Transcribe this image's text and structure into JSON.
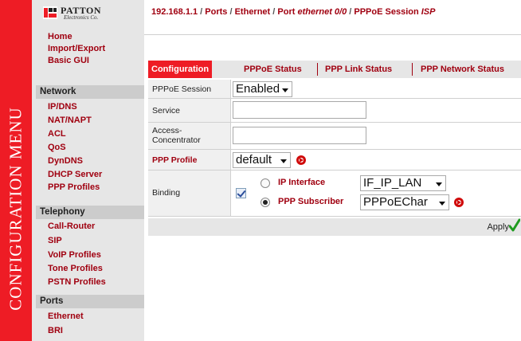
{
  "banner": {
    "text": "CONFIGURATION MENU",
    "color": "#ee1c25"
  },
  "logo": {
    "word": "PATTON",
    "sub": "Electronics Co."
  },
  "menu": {
    "top_items": [
      "Home",
      "Import/Export",
      "Basic GUI"
    ],
    "sections": [
      {
        "title": "Network",
        "items": [
          "IP/DNS",
          "NAT/NAPT",
          "ACL",
          "QoS",
          "DynDNS",
          "DHCP Server",
          "PPP Profiles"
        ]
      },
      {
        "title": "Telephony",
        "items": [
          "Call-Router",
          "SIP",
          "VoIP Profiles",
          "Tone Profiles",
          "PSTN Profiles"
        ]
      },
      {
        "title": "Ports",
        "items": [
          "Ethernet",
          "BRI"
        ]
      }
    ]
  },
  "breadcrumb": {
    "ip": "192.168.1.1",
    "sep": " / ",
    "ports": "Ports",
    "ethernet": "Ethernet",
    "port_prefix": "Port ",
    "port_name": "ethernet 0/0",
    "session_prefix": "PPPoE Session ",
    "session_name": "ISP"
  },
  "tabs": [
    {
      "label": "Configuration",
      "active": true
    },
    {
      "label": "PPPoE Status",
      "active": false
    },
    {
      "label": "PPP Link Status",
      "active": false
    },
    {
      "label": "PPP Network Status",
      "active": false
    }
  ],
  "form": {
    "pppoe_session": {
      "label": "PPPoE Session",
      "value": "Enabled"
    },
    "service": {
      "label": "Service",
      "value": ""
    },
    "access_concentrator": {
      "label_line1": "Access-",
      "label_line2": "Concentrator",
      "value": ""
    },
    "ppp_profile": {
      "label": "PPP Profile",
      "value": "default"
    },
    "binding": {
      "label": "Binding",
      "checked": true,
      "ip_interface": {
        "label": "IP Interface",
        "value": "IF_IP_LAN",
        "selected": false
      },
      "ppp_subscriber": {
        "label": "PPP Subscriber",
        "value": "PPPoEChar",
        "selected": true
      }
    }
  },
  "apply": {
    "label": "Apply"
  },
  "colors": {
    "accent": "#a00010",
    "tab_active": "#ee1c25",
    "menu_bg": "#e6e6e6",
    "section_bg": "#cccccc"
  }
}
